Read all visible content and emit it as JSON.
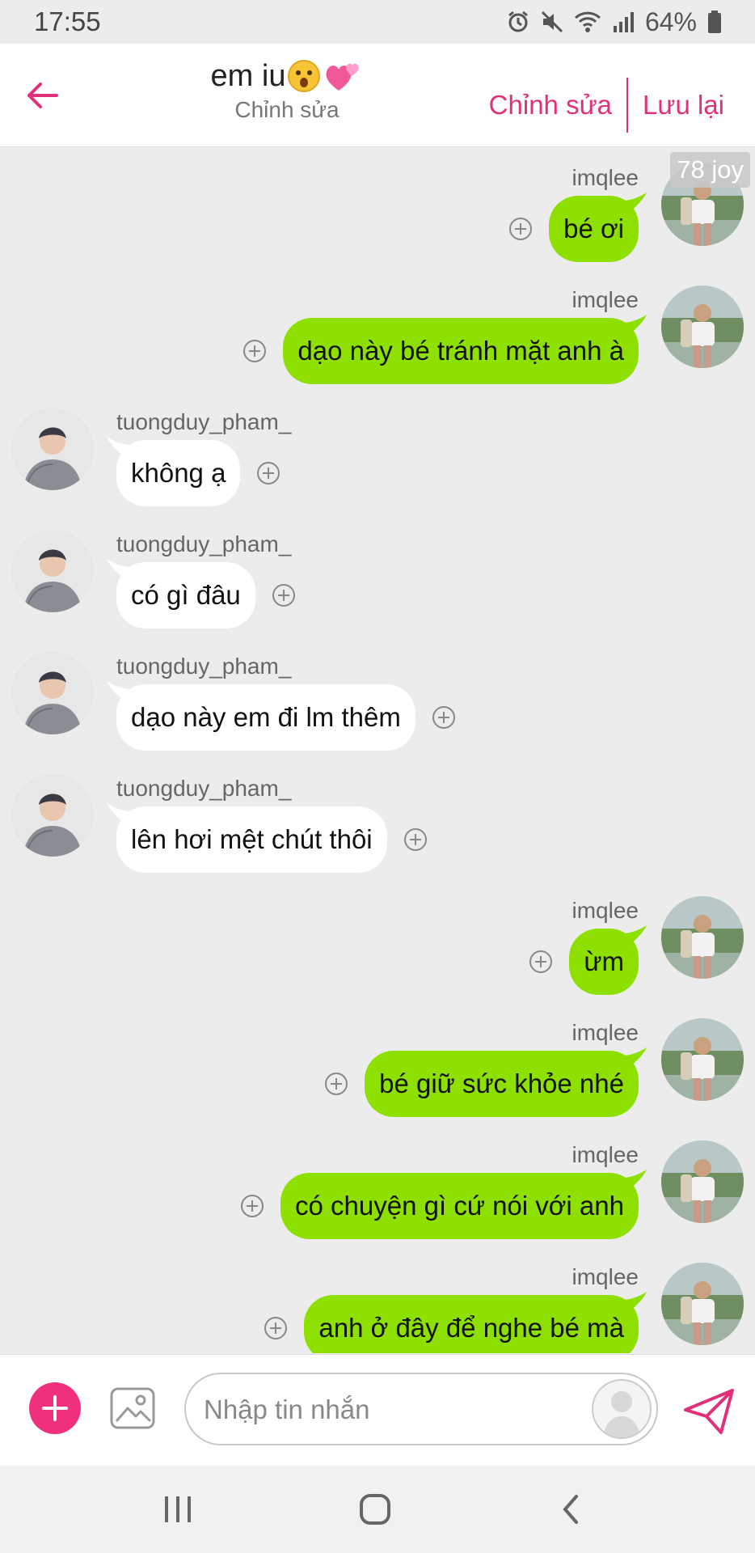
{
  "status_bar": {
    "time": "17:55",
    "battery": "64%"
  },
  "header": {
    "title": "em iu",
    "subtitle": "Chỉnh sửa",
    "edit_label": "Chỉnh sửa",
    "save_label": "Lưu lại"
  },
  "joy_badge": "78 joy",
  "messages": [
    {
      "side": "me",
      "sender": "imqlee",
      "text": "bé ơi"
    },
    {
      "side": "me",
      "sender": "imqlee",
      "text": "dạo này bé tránh mặt anh à"
    },
    {
      "side": "them",
      "sender": "tuongduy_pham_",
      "text": "không ạ"
    },
    {
      "side": "them",
      "sender": "tuongduy_pham_",
      "text": "có gì đâu"
    },
    {
      "side": "them",
      "sender": "tuongduy_pham_",
      "text": "dạo này em đi lm thêm"
    },
    {
      "side": "them",
      "sender": "tuongduy_pham_",
      "text": "lên hơi mệt chút thôi"
    },
    {
      "side": "me",
      "sender": "imqlee",
      "text": "ừm"
    },
    {
      "side": "me",
      "sender": "imqlee",
      "text": "bé giữ sức khỏe nhé"
    },
    {
      "side": "me",
      "sender": "imqlee",
      "text": "có chuyện gì cứ nói với anh"
    },
    {
      "side": "me",
      "sender": "imqlee",
      "text": "anh ở đây để nghe bé mà"
    }
  ],
  "input": {
    "placeholder": "Nhập tin nhắn"
  },
  "colors": {
    "accent": "#e0307a",
    "my_bubble": "#8ee000",
    "their_bubble": "#ffffff",
    "background": "#ececec"
  }
}
